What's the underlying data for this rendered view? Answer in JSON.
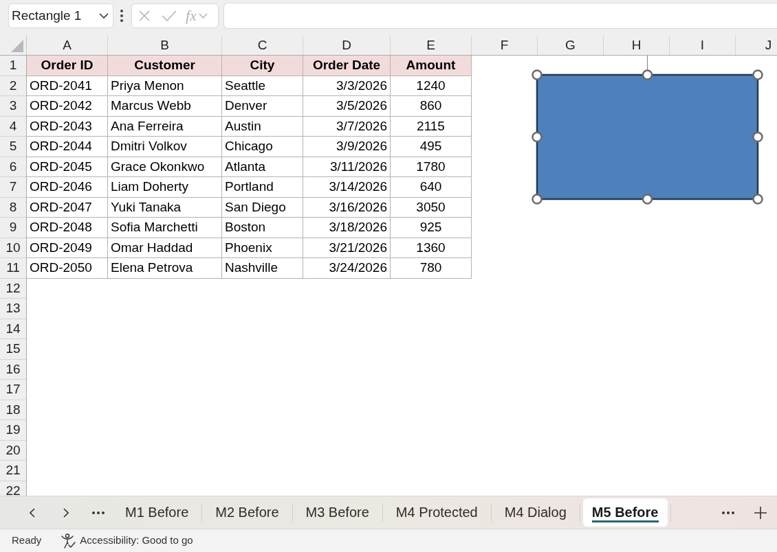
{
  "name_box": {
    "value": "Rectangle 1"
  },
  "formula_bar": {
    "disabled": true,
    "function_label": "fx"
  },
  "columns": [
    "A",
    "B",
    "C",
    "D",
    "E",
    "F",
    "G",
    "H",
    "I",
    "J"
  ],
  "row_numbers": [
    "1",
    "2",
    "3",
    "4",
    "5",
    "6",
    "7",
    "8",
    "9",
    "10",
    "11",
    "12",
    "13",
    "14",
    "15",
    "16",
    "17",
    "18",
    "19",
    "20",
    "21",
    "22"
  ],
  "table": {
    "header": [
      "Order ID",
      "Customer",
      "City",
      "Order Date",
      "Amount"
    ],
    "rows": [
      [
        "ORD-2041",
        "Priya Menon",
        "Seattle",
        "3/3/2026",
        "1240"
      ],
      [
        "ORD-2042",
        "Marcus Webb",
        "Denver",
        "3/5/2026",
        "860"
      ],
      [
        "ORD-2043",
        "Ana Ferreira",
        "Austin",
        "3/7/2026",
        "2115"
      ],
      [
        "ORD-2044",
        "Dmitri Volkov",
        "Chicago",
        "3/9/2026",
        "495"
      ],
      [
        "ORD-2045",
        "Grace Okonkwo",
        "Atlanta",
        "3/11/2026",
        "1780"
      ],
      [
        "ORD-2046",
        "Liam Doherty",
        "Portland",
        "3/14/2026",
        "640"
      ],
      [
        "ORD-2047",
        "Yuki Tanaka",
        "San Diego",
        "3/16/2026",
        "3050"
      ],
      [
        "ORD-2048",
        "Sofia Marchetti",
        "Boston",
        "3/18/2026",
        "925"
      ],
      [
        "ORD-2049",
        "Omar Haddad",
        "Phoenix",
        "3/21/2026",
        "1360"
      ],
      [
        "ORD-2050",
        "Elena Petrova",
        "Nashville",
        "3/24/2026",
        "780"
      ]
    ]
  },
  "shape": {
    "kind": "rectangle",
    "selected": true
  },
  "sheet_tabs": [
    {
      "label": "M1 Before",
      "selected": false
    },
    {
      "label": "M2 Before",
      "selected": false
    },
    {
      "label": "M3 Before",
      "selected": false
    },
    {
      "label": "M4 Protected",
      "selected": false
    },
    {
      "label": "M4 Dialog",
      "selected": false
    },
    {
      "label": "M5 Before",
      "selected": true
    }
  ],
  "status_bar": {
    "mode": "Ready",
    "accessibility": "Accessibility: Good to go"
  }
}
